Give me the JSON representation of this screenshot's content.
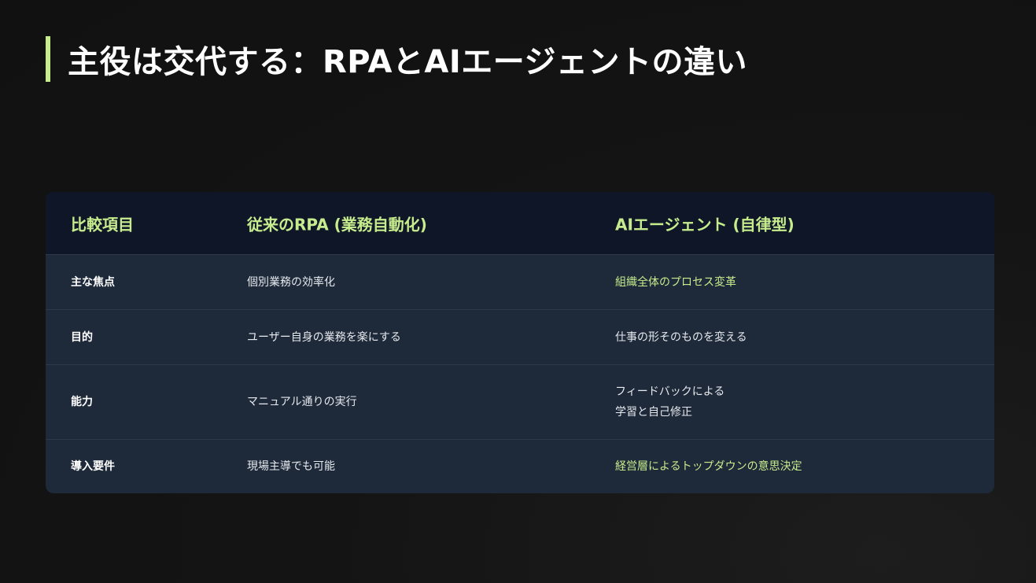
{
  "title": "主役は交代する：RPAとAIエージェントの違い",
  "colors": {
    "accent": "#c7ec8d",
    "background": "#121212",
    "table_header_bg": "#0e1627",
    "table_body_bg": "#1e2939"
  },
  "table": {
    "headers": [
      "比較項目",
      "従来のRPA (業務自動化)",
      "AIエージェント (自律型)"
    ],
    "rows": [
      {
        "item": "主な焦点",
        "rpa": "個別業務の効率化",
        "ai": "組織全体のプロセス変革",
        "ai_highlight": true
      },
      {
        "item": "目的",
        "rpa": "ユーザー自身の業務を楽にする",
        "ai": "仕事の形そのものを変える",
        "ai_highlight": false
      },
      {
        "item": "能力",
        "rpa": "マニュアル通りの実行",
        "ai_line1": "フィードバックによる",
        "ai_line2": "学習と自己修正",
        "ai_highlight": false
      },
      {
        "item": "導入要件",
        "rpa": "現場主導でも可能",
        "ai": "経営層によるトップダウンの意思決定",
        "ai_highlight": true
      }
    ]
  }
}
